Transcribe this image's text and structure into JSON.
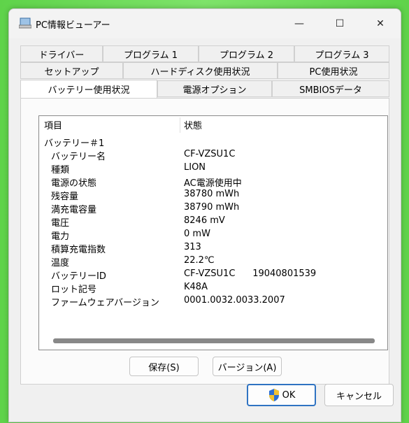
{
  "window": {
    "title": "PC情報ビューアー"
  },
  "title_buttons": {
    "minimize": "—",
    "maximize": "☐",
    "close": "✕"
  },
  "tabs": {
    "row1": [
      "ドライバー",
      "プログラム 1",
      "プログラム 2",
      "プログラム 3"
    ],
    "row2": [
      "セットアップ",
      "ハードディスク使用状況",
      "PC使用状況"
    ],
    "row3": [
      "バッテリー使用状況",
      "電源オプション",
      "SMBIOSデータ"
    ],
    "active": "バッテリー使用状況"
  },
  "list": {
    "headers": [
      "項目",
      "状態"
    ],
    "group": "バッテリー＃1",
    "rows": [
      {
        "item": "バッテリー名",
        "value": "CF-VZSU1C"
      },
      {
        "item": "種類",
        "value": "LION"
      },
      {
        "item": "電源の状態",
        "value": "AC電源使用中"
      },
      {
        "item": "残容量",
        "value": "38780 mWh"
      },
      {
        "item": "満充電容量",
        "value": "38790 mWh"
      },
      {
        "item": "電圧",
        "value": "8246 mV"
      },
      {
        "item": "電力",
        "value": "0 mW"
      },
      {
        "item": "積算充電指数",
        "value": "313"
      },
      {
        "item": "温度",
        "value": "22.2℃"
      },
      {
        "item": "バッテリーID",
        "value": "CF-VZSU1C      19040801539"
      },
      {
        "item": "ロット記号",
        "value": "K48A"
      },
      {
        "item": "ファームウェアバージョン",
        "value": "0001.0032.0033.2007"
      }
    ]
  },
  "buttons": {
    "save": "保存(S)",
    "version": "バージョン(A)",
    "ok": "OK",
    "cancel": "キャンセル"
  },
  "colors": {
    "accent": "#2f73c2",
    "background": "#5fd34a"
  }
}
